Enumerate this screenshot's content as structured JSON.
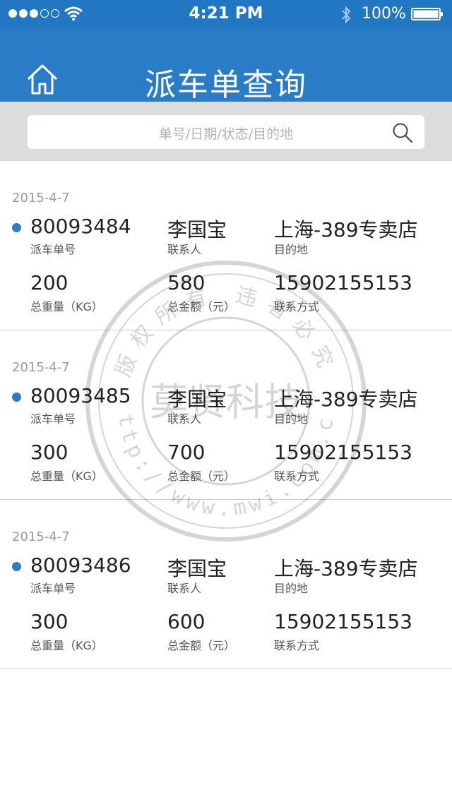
{
  "status_bar": {
    "time": "4:21 PM",
    "battery": "100%",
    "icons": [
      "signal-dots",
      "wifi-icon",
      "bluetooth-icon",
      "battery-icon"
    ]
  },
  "header": {
    "title": "派车单查询",
    "home_icon": "home-icon"
  },
  "search": {
    "placeholder": "单号/日期/状态/目的地",
    "icon": "search-icon"
  },
  "labels": {
    "order_no": "派车单号",
    "contact": "联系人",
    "destination": "目的地",
    "weight": "总重量（KG）",
    "amount": "总金额（元）",
    "phone": "联系方式"
  },
  "orders": [
    {
      "date": "2015-4-7",
      "order_no": "80093484",
      "contact": "李国宝",
      "destination": "上海-389专卖店",
      "weight": "200",
      "amount": "580",
      "phone": "15902155153"
    },
    {
      "date": "2015-4-7",
      "order_no": "80093485",
      "contact": "李国宝",
      "destination": "上海-389专卖店",
      "weight": "300",
      "amount": "700",
      "phone": "15902155153"
    },
    {
      "date": "2015-4-7",
      "order_no": "80093486",
      "contact": "李国宝",
      "destination": "上海-389专卖店",
      "weight": "300",
      "amount": "600",
      "phone": "15902155153"
    }
  ],
  "watermark": {
    "center_text": "莫贤科技",
    "url_text": "http://www.mwi.com.cn",
    "top_text": "版权所有 违者必究"
  },
  "colors": {
    "status_bar": "#2277c3",
    "nav_bar": "#2b7cc6",
    "search_bg": "#dcdcdc",
    "bullet": "#2b7cc6",
    "divider": "#cccccc"
  }
}
